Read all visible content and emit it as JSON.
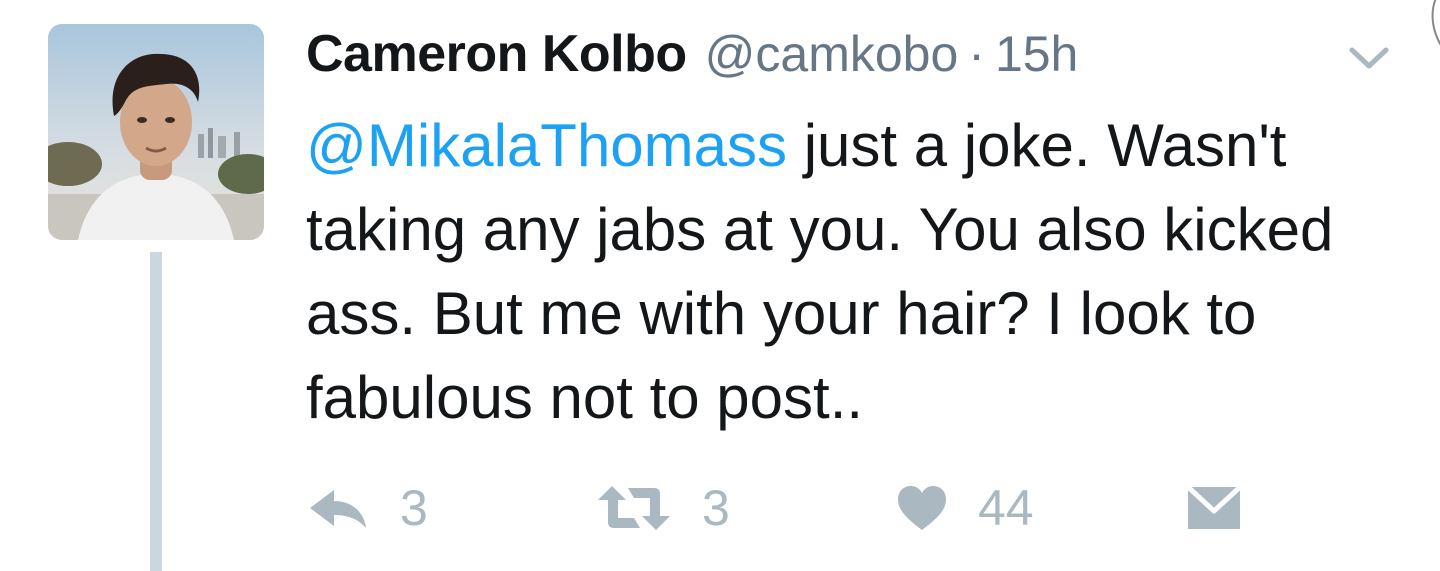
{
  "tweet": {
    "author": {
      "display_name": "Cameron Kolbo",
      "handle": "@camkobo",
      "separator": "·",
      "timestamp": "15h"
    },
    "body": {
      "mention": "@MikalaThomass",
      "text": " just a joke. Wasn't taking any jabs at you. You also kicked ass. But me with your hair? I look to fabulous not to post.."
    },
    "actions": {
      "reply": {
        "icon": "reply-icon",
        "count": "3"
      },
      "retweet": {
        "icon": "retweet-icon",
        "count": "3"
      },
      "like": {
        "icon": "heart-icon",
        "count": "44"
      },
      "dm": {
        "icon": "envelope-icon"
      }
    }
  },
  "colors": {
    "text": "#14171a",
    "muted": "#657786",
    "action_gray": "#aab8c2",
    "link_blue": "#1da1f2",
    "thread_line": "#ccd6dd"
  }
}
